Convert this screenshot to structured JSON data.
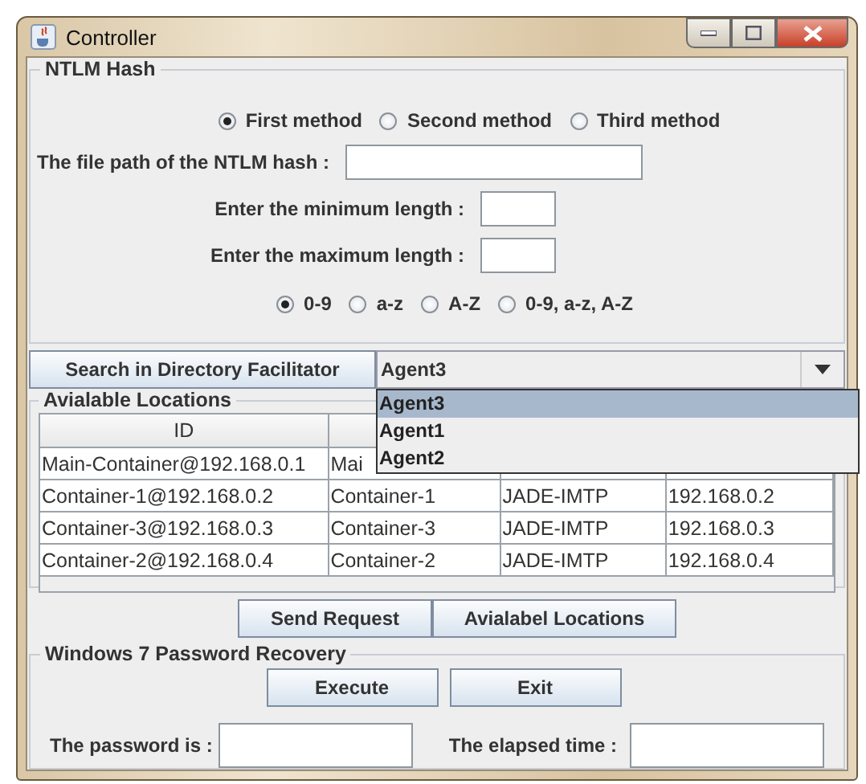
{
  "window": {
    "title": "Controller"
  },
  "ntlm_hash": {
    "title": "NTLM Hash",
    "methods": [
      {
        "label": "First method",
        "selected": true
      },
      {
        "label": "Second method",
        "selected": false
      },
      {
        "label": "Third method",
        "selected": false
      }
    ],
    "fields": [
      {
        "label": "The file path of the NTLM hash :",
        "kind": "wide"
      },
      {
        "label": "Enter the minimum length :",
        "kind": "short"
      },
      {
        "label": "Enter the maximum length :",
        "kind": "short"
      }
    ],
    "charsets": [
      {
        "label": "0-9",
        "selected": true
      },
      {
        "label": "a-z",
        "selected": false
      },
      {
        "label": "A-Z",
        "selected": false
      },
      {
        "label": "0-9,  a-z,  A-Z",
        "selected": false
      }
    ]
  },
  "search": {
    "button": "Search in Directory Facilitator",
    "combo_value": "Agent3",
    "options": [
      {
        "label": "Agent3",
        "selected": true
      },
      {
        "label": "Agent1",
        "selected": false
      },
      {
        "label": "Agent2",
        "selected": false
      }
    ]
  },
  "locations": {
    "title": "Avialable Locations",
    "columns": [
      "ID"
    ],
    "rows": [
      [
        "Main-Container@192.168.0.1",
        "Mai"
      ],
      [
        "Container-1@192.168.0.2",
        "Container-1",
        "JADE-IMTP",
        "192.168.0.2"
      ],
      [
        "Container-3@192.168.0.3",
        "Container-3",
        "JADE-IMTP",
        "192.168.0.3"
      ],
      [
        "Container-2@192.168.0.4",
        "Container-2",
        "JADE-IMTP",
        "192.168.0.4"
      ]
    ],
    "buttons": [
      "Send Request",
      "Avialabel Locations"
    ]
  },
  "recovery": {
    "title": "Windows 7 Password Recovery",
    "buttons": [
      "Execute",
      "Exit"
    ],
    "fields": [
      {
        "label": "The password is :"
      },
      {
        "label": "The elapsed time :"
      }
    ]
  }
}
